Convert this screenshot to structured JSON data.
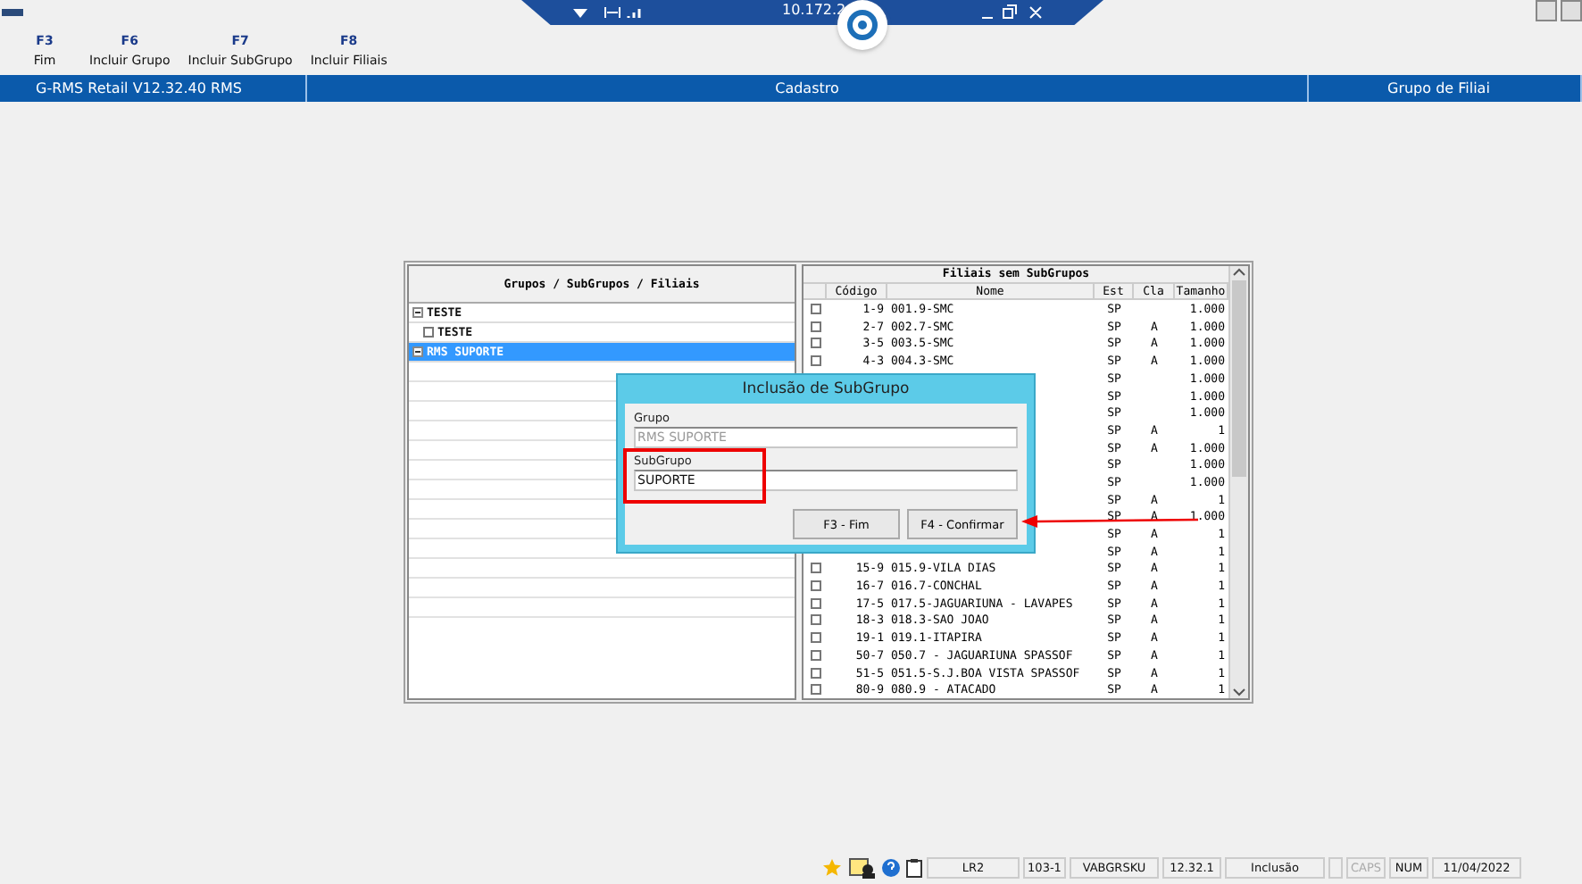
{
  "remote_bar": {
    "address": "10.172.2"
  },
  "toolbar": [
    {
      "key": "F3",
      "label": "Fim"
    },
    {
      "key": "F6",
      "label": "Incluir Grupo"
    },
    {
      "key": "F7",
      "label": "Incluir SubGrupo"
    },
    {
      "key": "F8",
      "label": "Incluir Filiais"
    }
  ],
  "title_bar": {
    "app": "G-RMS Retail V12.32.40 RMS",
    "section": "Cadastro",
    "screen": "Grupo de Filiai"
  },
  "tree": {
    "title": "Grupos / SubGrupos / Filiais",
    "items": [
      {
        "label": "TESTE",
        "expanded": true,
        "selected": false,
        "children": [
          {
            "label": "TESTE",
            "checked": false,
            "selected": false
          }
        ]
      },
      {
        "label": "RMS SUPORTE",
        "expanded": true,
        "selected": true
      }
    ]
  },
  "table": {
    "title": "Filiais sem SubGrupos",
    "columns": [
      "Código",
      "Nome",
      "Est",
      "Cla",
      "Tamanho"
    ],
    "rows": [
      {
        "checked": false,
        "code": "1-9",
        "name": "001.9-SMC",
        "est": "SP",
        "cla": "",
        "size": "1.000"
      },
      {
        "checked": false,
        "code": "2-7",
        "name": "002.7-SMC",
        "est": "SP",
        "cla": "A",
        "size": "1.000"
      },
      {
        "checked": false,
        "code": "3-5",
        "name": "003.5-SMC",
        "est": "SP",
        "cla": "A",
        "size": "1.000"
      },
      {
        "checked": false,
        "code": "4-3",
        "name": "004.3-SMC",
        "est": "SP",
        "cla": "A",
        "size": "1.000"
      },
      {
        "est": "SP",
        "cla": "",
        "size": "1.000"
      },
      {
        "est": "SP",
        "cla": "",
        "size": "1.000"
      },
      {
        "est": "SP",
        "cla": "",
        "size": "1.000"
      },
      {
        "est": "SP",
        "cla": "A",
        "size": "1"
      },
      {
        "est": "SP",
        "cla": "A",
        "size": "1.000"
      },
      {
        "est": "SP",
        "cla": "",
        "size": "1.000"
      },
      {
        "est": "SP",
        "cla": "",
        "size": "1.000"
      },
      {
        "est": "SP",
        "cla": "A",
        "size": "1"
      },
      {
        "est": "SP",
        "cla": "A",
        "size": "1.000"
      },
      {
        "est": "SP",
        "cla": "A",
        "size": "1"
      },
      {
        "est": "SP",
        "cla": "A",
        "size": "1"
      },
      {
        "checked": false,
        "code": "15-9",
        "name": "015.9-VILA DIAS",
        "est": "SP",
        "cla": "A",
        "size": "1"
      },
      {
        "checked": false,
        "code": "16-7",
        "name": "016.7-CONCHAL",
        "est": "SP",
        "cla": "A",
        "size": "1"
      },
      {
        "checked": false,
        "code": "17-5",
        "name": "017.5-JAGUARIUNA - LAVAPES",
        "est": "SP",
        "cla": "A",
        "size": "1"
      },
      {
        "checked": false,
        "code": "18-3",
        "name": "018.3-SAO JOAO",
        "est": "SP",
        "cla": "A",
        "size": "1"
      },
      {
        "checked": false,
        "code": "19-1",
        "name": "019.1-ITAPIRA",
        "est": "SP",
        "cla": "A",
        "size": "1"
      },
      {
        "checked": false,
        "code": "50-7",
        "name": "050.7 - JAGUARIUNA SPASSOF",
        "est": "SP",
        "cla": "A",
        "size": "1"
      },
      {
        "checked": false,
        "code": "51-5",
        "name": "051.5-S.J.BOA VISTA SPASSOF",
        "est": "SP",
        "cla": "A",
        "size": "1"
      },
      {
        "checked": false,
        "code": "80-9",
        "name": "080.9 - ATACADO",
        "est": "SP",
        "cla": "A",
        "size": "1"
      }
    ]
  },
  "dialog": {
    "title": "Inclusão de SubGrupo",
    "fields": [
      {
        "label": "Grupo",
        "value": "RMS SUPORTE",
        "disabled": true,
        "highlighted": false
      },
      {
        "label": "SubGrupo",
        "value": "SUPORTE",
        "disabled": false,
        "highlighted": true
      }
    ],
    "buttons": [
      "F3 - Fim",
      "F4 - Confirmar"
    ]
  },
  "status_bar": {
    "cells": [
      "LR2",
      "103-1",
      "VABGRSKU",
      "12.32.1",
      "Inclusão"
    ],
    "indicators": [
      {
        "label": "CAPS",
        "on": false
      },
      {
        "label": "NUM",
        "on": true
      }
    ],
    "date": "11/04/2022"
  }
}
